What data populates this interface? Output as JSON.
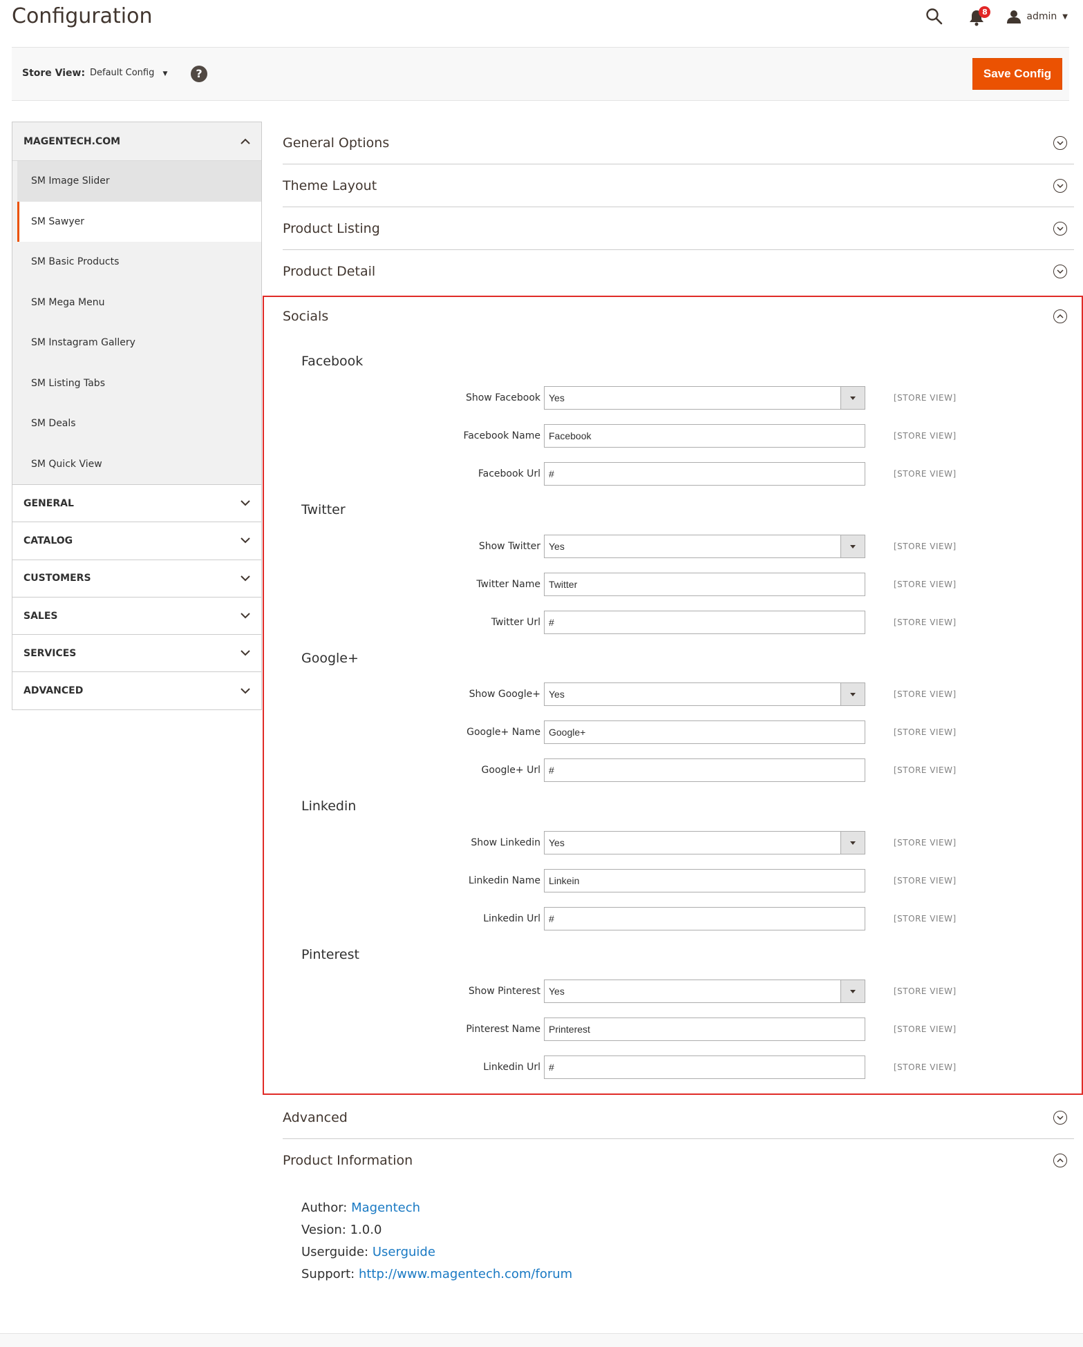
{
  "header": {
    "title": "Configuration",
    "notification_count": "8",
    "user_name": "admin"
  },
  "store_bar": {
    "label": "Store View:",
    "selected": "Default Config",
    "help": "?",
    "save_label": "Save Config"
  },
  "sidebar": {
    "group_title": "MAGENTECH.COM",
    "items": [
      {
        "label": "SM Image Slider"
      },
      {
        "label": "SM Sawyer"
      },
      {
        "label": "SM Basic Products"
      },
      {
        "label": "SM Mega Menu"
      },
      {
        "label": "SM Instagram Gallery"
      },
      {
        "label": "SM Listing Tabs"
      },
      {
        "label": "SM Deals"
      },
      {
        "label": "SM Quick View"
      }
    ],
    "categories": [
      "GENERAL",
      "CATALOG",
      "CUSTOMERS",
      "SALES",
      "SERVICES",
      "ADVANCED"
    ]
  },
  "sections_before": [
    "General Options",
    "Theme Layout",
    "Product Listing",
    "Product Detail"
  ],
  "socials": {
    "title": "Socials",
    "scope": "[STORE VIEW]",
    "groups": [
      {
        "title": "Facebook",
        "rows": [
          {
            "label": "Show Facebook",
            "value": "Yes",
            "type": "select"
          },
          {
            "label": "Facebook Name",
            "value": "Facebook",
            "type": "text"
          },
          {
            "label": "Facebook Url",
            "value": "#",
            "type": "text"
          }
        ]
      },
      {
        "title": "Twitter",
        "rows": [
          {
            "label": "Show Twitter",
            "value": "Yes",
            "type": "select"
          },
          {
            "label": "Twitter Name",
            "value": "Twitter",
            "type": "text"
          },
          {
            "label": "Twitter Url",
            "value": "#",
            "type": "text"
          }
        ]
      },
      {
        "title": "Google+",
        "rows": [
          {
            "label": "Show Google+",
            "value": "Yes",
            "type": "select"
          },
          {
            "label": "Google+ Name",
            "value": "Google+",
            "type": "text"
          },
          {
            "label": "Google+ Url",
            "value": "#",
            "type": "text"
          }
        ]
      },
      {
        "title": "Linkedin",
        "rows": [
          {
            "label": "Show Linkedin",
            "value": "Yes",
            "type": "select"
          },
          {
            "label": "Linkedin Name",
            "value": "Linkein",
            "type": "text"
          },
          {
            "label": "Linkedin Url",
            "value": "#",
            "type": "text"
          }
        ]
      },
      {
        "title": "Pinterest",
        "rows": [
          {
            "label": "Show Pinterest",
            "value": "Yes",
            "type": "select"
          },
          {
            "label": "Pinterest Name",
            "value": "Printerest",
            "type": "text"
          },
          {
            "label": "Linkedin Url",
            "value": "#",
            "type": "text"
          }
        ]
      }
    ]
  },
  "sections_after": [
    "Advanced",
    "Product Information"
  ],
  "product_info": {
    "author_label": "Author:",
    "author_value": "Magentech",
    "version_label": "Vesion:",
    "version_value": "1.0.0",
    "guide_label": "Userguide:",
    "guide_value": "Userguide",
    "support_label": "Support:",
    "support_value": "http://www.magentech.com/forum"
  },
  "colors": {
    "accent": "#eb5202",
    "highlight_border": "#e02b27",
    "link": "#1979c3"
  }
}
